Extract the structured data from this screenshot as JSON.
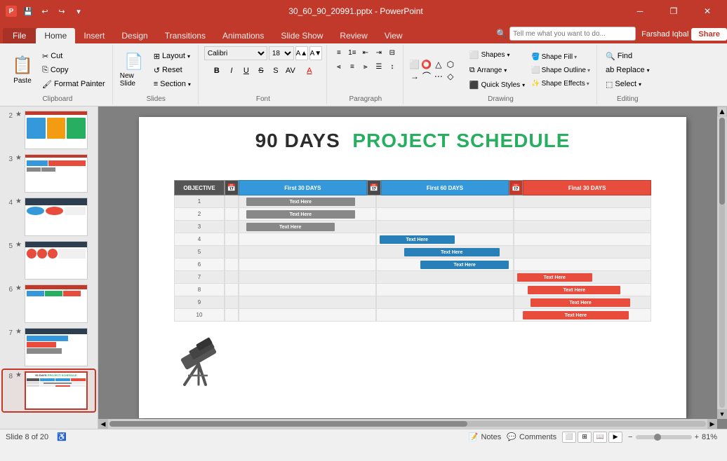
{
  "titleBar": {
    "title": "30_60_90_20991.pptx - PowerPoint",
    "quickAccess": [
      "save",
      "undo",
      "redo",
      "customize"
    ]
  },
  "tabs": [
    "File",
    "Home",
    "Insert",
    "Design",
    "Transitions",
    "Animations",
    "Slide Show",
    "Review",
    "View"
  ],
  "activeTab": "Home",
  "ribbon": {
    "clipboard": {
      "label": "Clipboard",
      "paste": "Paste",
      "cut": "Cut",
      "copy": "Copy",
      "formatPainter": "Format Painter"
    },
    "slides": {
      "label": "Slides",
      "newSlide": "New Slide",
      "layout": "Layout",
      "reset": "Reset",
      "section": "Section"
    },
    "font": {
      "label": "Font",
      "fontName": "Calibri",
      "fontSize": "18",
      "bold": "B",
      "italic": "I",
      "underline": "U",
      "strikethrough": "S",
      "shadow": "A",
      "charSpacing": "AV",
      "fontColor": "A",
      "increaseFontSize": "A",
      "decreaseFontSize": "A"
    },
    "paragraph": {
      "label": "Paragraph"
    },
    "drawing": {
      "label": "Drawing",
      "shapeFill": "Shape Fill",
      "shapeOutline": "Shape Outline",
      "shapeEffects": "Shape Effects",
      "shapes": "Shapes",
      "arrange": "Arrange",
      "quickStyles": "Quick Styles"
    },
    "editing": {
      "label": "Editing",
      "find": "Find",
      "replace": "Replace",
      "select": "Select"
    }
  },
  "search": {
    "placeholder": "Tell me what you want to do..."
  },
  "user": {
    "name": "Farshad Iqbal",
    "share": "Share"
  },
  "slidePanel": {
    "slides": [
      {
        "num": "2",
        "star": "★"
      },
      {
        "num": "3",
        "star": "★"
      },
      {
        "num": "4",
        "star": "★"
      },
      {
        "num": "5",
        "star": "★"
      },
      {
        "num": "6",
        "star": "★"
      },
      {
        "num": "7",
        "star": "★"
      },
      {
        "num": "8",
        "star": "★",
        "active": true
      }
    ]
  },
  "slide": {
    "titleBlack": "90 DAYS",
    "titleGreen": "PROJECT SCHEDULE",
    "objective": "OBJECTIVE",
    "col30": "First 30 DAYS",
    "col60": "First 60 DAYS",
    "col90": "Final 30 DAYS",
    "rows": [
      {
        "num": "1",
        "bar30": "Text Here",
        "bar30pos": 10,
        "bar30w": 80
      },
      {
        "num": "2",
        "bar30": "Text Here",
        "bar30pos": 10,
        "bar30w": 80
      },
      {
        "num": "3",
        "bar30": "Text Here",
        "bar30pos": 10,
        "bar30w": 60
      },
      {
        "num": "4",
        "bar60": "Text Here",
        "bar60pos": 0,
        "bar60w": 60
      },
      {
        "num": "5",
        "bar60": "Text Here",
        "bar60pos": 20,
        "bar60w": 75
      },
      {
        "num": "6",
        "bar60": "Text Here",
        "bar60pos": 30,
        "bar60w": 75
      },
      {
        "num": "7",
        "bar90": "Text Here",
        "bar90pos": 0,
        "bar90w": 60
      },
      {
        "num": "8",
        "bar90": "Text Here",
        "bar90pos": 10,
        "bar90w": 70
      },
      {
        "num": "9",
        "bar90": "Text Here",
        "bar90pos": 10,
        "bar90w": 75
      },
      {
        "num": "10",
        "bar90": "Text Here",
        "bar90pos": 5,
        "bar90w": 80
      }
    ]
  },
  "statusBar": {
    "slideInfo": "Slide 8 of 20",
    "notes": "Notes",
    "comments": "Comments",
    "zoom": "81%"
  }
}
